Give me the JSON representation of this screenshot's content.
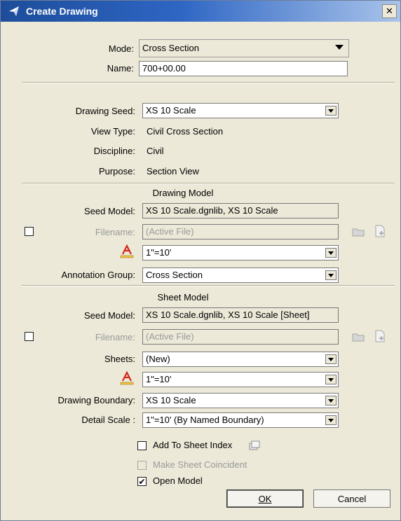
{
  "window": {
    "title": "Create Drawing",
    "close_glyph": "✕"
  },
  "mode": {
    "label": "Mode:",
    "value": "Cross Section"
  },
  "name": {
    "label": "Name:",
    "value": "700+00.00"
  },
  "drawing_seed": {
    "label": "Drawing Seed:",
    "value": "XS 10 Scale"
  },
  "view_type": {
    "label": "View Type:",
    "value": "Civil Cross Section"
  },
  "discipline": {
    "label": "Discipline:",
    "value": "Civil"
  },
  "purpose": {
    "label": "Purpose:",
    "value": "Section View"
  },
  "drawing_model": {
    "title": "Drawing Model",
    "seed_model_label": "Seed Model:",
    "seed_model_value": "XS 10 Scale.dgnlib, XS 10 Scale",
    "filename_label": "Filename:",
    "filename_value": "(Active File)",
    "annotation_scale_value": "1\"=10'",
    "annotation_group_label": "Annotation Group:",
    "annotation_group_value": "Cross Section",
    "filename_checked": false
  },
  "sheet_model": {
    "title": "Sheet Model",
    "seed_model_label": "Seed Model:",
    "seed_model_value": "XS 10 Scale.dgnlib, XS 10 Scale [Sheet]",
    "filename_label": "Filename:",
    "filename_value": "(Active File)",
    "sheets_label": "Sheets:",
    "sheets_value": "(New)",
    "annotation_scale_value": "1\"=10'",
    "drawing_boundary_label": "Drawing Boundary:",
    "drawing_boundary_value": "XS 10 Scale",
    "detail_scale_label": "Detail Scale :",
    "detail_scale_value": "1\"=10' (By Named Boundary)",
    "filename_checked": false
  },
  "options": {
    "add_to_sheet_index": {
      "label": "Add To Sheet Index",
      "checked": false
    },
    "make_sheet_coincident": {
      "label": "Make Sheet Coincident",
      "checked": false
    },
    "open_model": {
      "label": "Open Model",
      "checked": true,
      "check_glyph": "✔"
    }
  },
  "buttons": {
    "ok": "OK",
    "cancel": "Cancel"
  },
  "icons": {
    "title": "drawing-app-icon",
    "folder": "folder-icon",
    "new_file": "new-file-icon",
    "annotation_scale": "annotation-scale-icon",
    "sheet_index": "sheet-index-icon"
  },
  "colors": {
    "titlebar": "#2f66c4",
    "annotation_icon": "#d32a1e",
    "background": "#ece9d8"
  }
}
